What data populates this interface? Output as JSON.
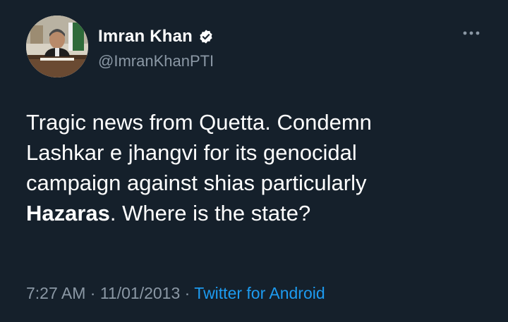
{
  "author": {
    "display_name": "Imran Khan",
    "handle": "@ImranKhanPTI",
    "verified": true
  },
  "tweet": {
    "line1": "Tragic news from Quetta. Condemn",
    "line2": "Lashkar e jhangvi for its genocidal",
    "line3": "campaign against shias particularly",
    "line4_bold": "Hazaras",
    "line4_rest": ". Where is the state?"
  },
  "meta": {
    "time": "7:27 AM",
    "separator": "·",
    "date": "11/01/2013",
    "source": "Twitter for Android"
  },
  "colors": {
    "background": "#15202b",
    "secondary_text": "#8b98a5",
    "link": "#1d9bf0",
    "verified_badge": "#ffffff"
  },
  "icons": {
    "verified": "verified-badge-icon",
    "more": "more-options-icon"
  }
}
